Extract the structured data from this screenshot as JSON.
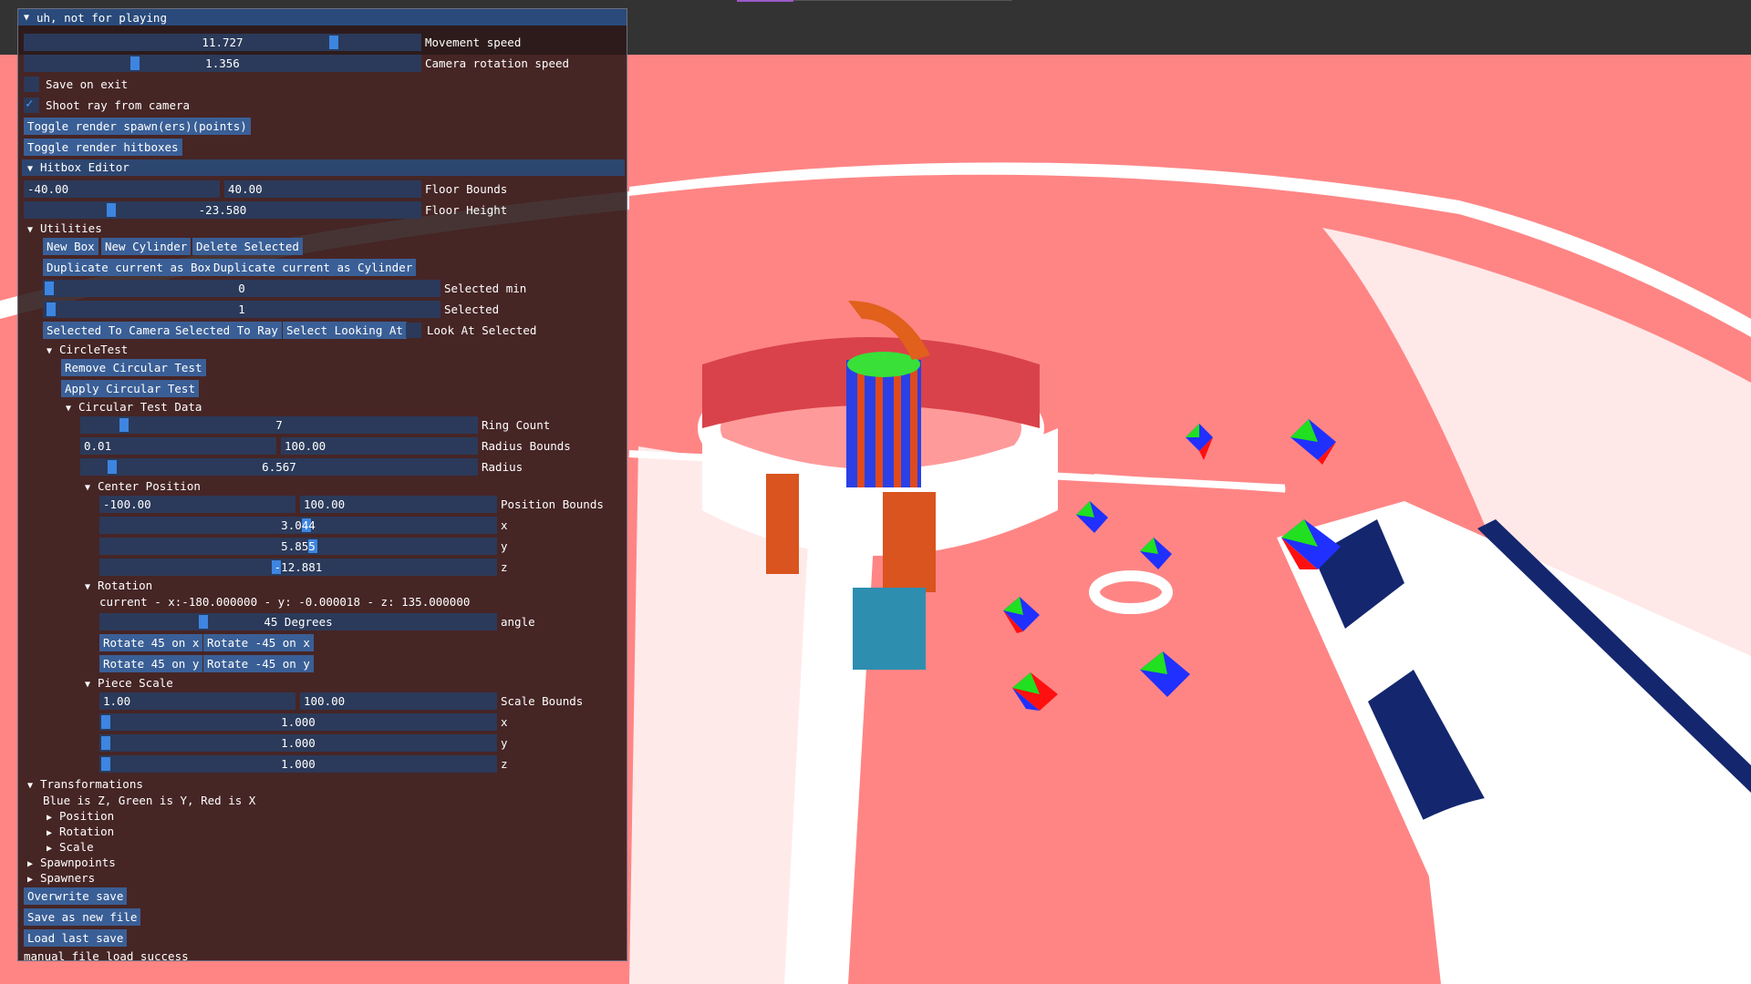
{
  "window": {
    "title": "uh, not for playing",
    "movement_speed": {
      "value": "11.727",
      "label": "Movement speed",
      "fraction": 0.77
    },
    "camera_rotation_speed": {
      "value": "1.356",
      "label": "Camera rotation speed",
      "fraction": 0.27
    },
    "save_on_exit": {
      "label": "Save on exit",
      "checked": false
    },
    "shoot_ray": {
      "label": "Shoot ray from camera",
      "checked": true
    },
    "toggle_spawn_btn": "Toggle render spawn(ers)(points)",
    "toggle_hitbox_btn": "Toggle render hitboxes"
  },
  "hitbox_editor": {
    "header": "Hitbox Editor",
    "floor_bounds": {
      "min": "-40.00",
      "max": "40.00",
      "label": "Floor Bounds"
    },
    "floor_height": {
      "value": "-23.580",
      "label": "Floor Height",
      "fraction": 0.2
    },
    "utilities": {
      "label": "Utilities",
      "new_box": "New Box",
      "new_cylinder": "New Cylinder",
      "delete_selected": "Delete Selected",
      "dup_box": "Duplicate current as Box",
      "dup_cylinder": "Duplicate current as Cylinder",
      "selected_min": {
        "value": "0",
        "label": "Selected min"
      },
      "selected": {
        "value": "1",
        "label": "Selected"
      },
      "selected_to_camera": "Selected To Camera",
      "selected_to_ray": "Selected To Ray",
      "select_looking_at": "Select Looking At",
      "look_at_selected": "Look At Selected"
    },
    "circle_test": {
      "label": "CircleTest",
      "remove": "Remove Circular Test",
      "apply": "Apply Circular Test",
      "data_label": "Circular Test Data",
      "ring_count": {
        "value": "7",
        "label": "Ring Count"
      },
      "radius_bounds": {
        "min": "0.01",
        "max": "100.00",
        "label": "Radius Bounds"
      },
      "radius": {
        "value": "6.567",
        "label": "Radius"
      },
      "center_position": {
        "label": "Center Position",
        "bounds": {
          "min": "-100.00",
          "max": "100.00",
          "label": "Position Bounds"
        },
        "x": {
          "value": "3.044",
          "label": "x"
        },
        "y": {
          "value": "5.855",
          "label": "y"
        },
        "z": {
          "value": "-12.881",
          "label": "z"
        }
      },
      "rotation": {
        "label": "Rotation",
        "current": "current - x:-180.000000 - y: -0.000018 - z: 135.000000",
        "angle": {
          "value": "45 Degrees",
          "label": "angle"
        },
        "rot_pos_x": "Rotate 45 on x",
        "rot_neg_x": "Rotate -45 on x",
        "rot_pos_y": "Rotate 45 on y",
        "rot_neg_y": "Rotate -45 on y"
      },
      "piece_scale": {
        "label": "Piece Scale",
        "bounds": {
          "min": "1.00",
          "max": "100.00",
          "label": "Scale Bounds"
        },
        "x": {
          "value": "1.000",
          "label": "x"
        },
        "y": {
          "value": "1.000",
          "label": "y"
        },
        "z": {
          "value": "1.000",
          "label": "z"
        }
      }
    }
  },
  "transformations": {
    "label": "Transformations",
    "legend": "Blue is Z, Green is Y, Red is X",
    "position": "Position",
    "rotation": "Rotation",
    "scale": "Scale"
  },
  "spawnpoints": "Spawnpoints",
  "spawners": "Spawners",
  "overwrite_save": "Overwrite save",
  "save_as_new": "Save as new file",
  "load_last": "Load last save",
  "status": "manual file load success",
  "colors": {
    "accent": "#3d85e0",
    "button": "#3a5f96",
    "frame": "#2b3a5a",
    "scene": "#ff8585"
  }
}
